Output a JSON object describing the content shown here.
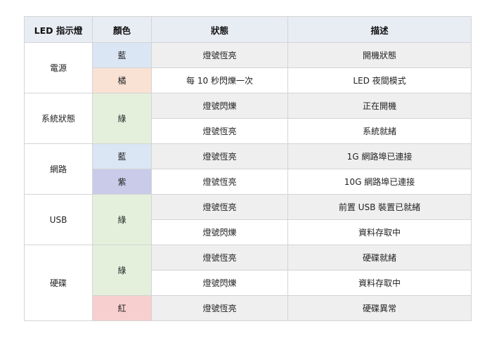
{
  "headers": {
    "indicator": "LED 指示燈",
    "color": "顏色",
    "status": "狀態",
    "description": "描述"
  },
  "groups": [
    {
      "component": "電源",
      "rows": [
        {
          "color": "藍",
          "status": "燈號恆亮",
          "description": "開機狀態"
        },
        {
          "color": "橘",
          "status": "每 10 秒閃爍一次",
          "description": "LED 夜間模式"
        }
      ]
    },
    {
      "component": "系統狀態",
      "rows": [
        {
          "color": "綠",
          "status": "燈號閃爍",
          "description": "正在開機"
        },
        {
          "color": "",
          "status": "燈號恆亮",
          "description": "系統就緒"
        }
      ]
    },
    {
      "component": "網路",
      "rows": [
        {
          "color": "藍",
          "status": "燈號恆亮",
          "description": "1G 網路埠已連接"
        },
        {
          "color": "紫",
          "status": "燈號恆亮",
          "description": "10G 網路埠已連接"
        }
      ]
    },
    {
      "component": "USB",
      "rows": [
        {
          "color": "綠",
          "status": "燈號恆亮",
          "description": "前置 USB 裝置已就緒"
        },
        {
          "color": "",
          "status": "燈號閃爍",
          "description": "資料存取中"
        }
      ]
    },
    {
      "component": "硬碟",
      "rows": [
        {
          "color": "綠",
          "status": "燈號恆亮",
          "description": "硬碟就緒"
        },
        {
          "color": "",
          "status": "燈號閃爍",
          "description": "資料存取中"
        },
        {
          "color": "紅",
          "status": "燈號恆亮",
          "description": "硬碟異常"
        }
      ]
    }
  ],
  "swatch_colors": {
    "blue": "#dbe6f4",
    "orange": "#f9e2d4",
    "green": "#e4f0dc",
    "purple": "#c9cbe9",
    "red": "#f8cfcf",
    "header": "#e8edf4",
    "row_shade": "#efefef"
  }
}
